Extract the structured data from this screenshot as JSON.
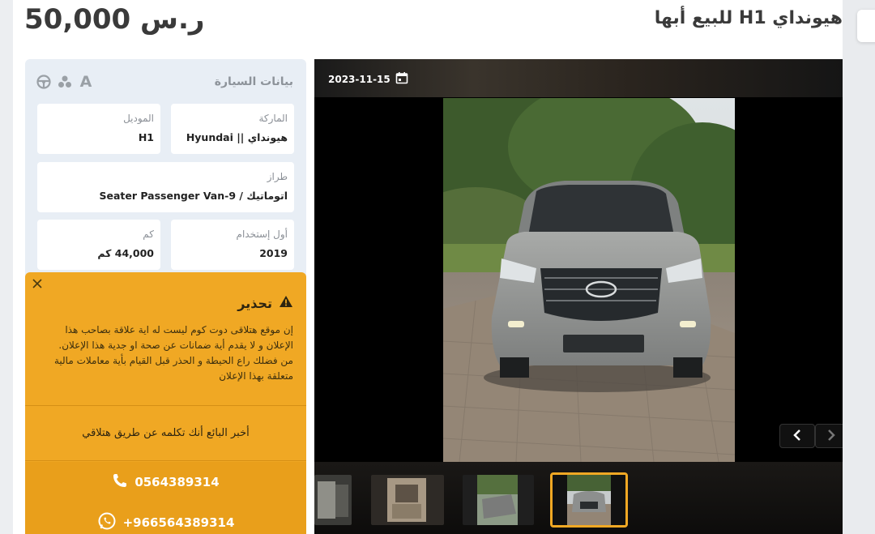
{
  "header": {
    "price": "50,000 ر.س",
    "title": "هيونداي H1 للبيع أبها"
  },
  "car_info": {
    "section_title": "بيانات السيارة",
    "icons": [
      "steering-wheel-icon",
      "recycle-icon",
      "automatic-transmission-icon"
    ],
    "fields": [
      {
        "label": "الماركة",
        "value": "هيونداي || Hyundai"
      },
      {
        "label": "الموديل",
        "value": "H1"
      },
      {
        "label": "طراز",
        "value": "اتوماتيك / 9-Seater Passenger Van"
      },
      {
        "label": "أول إستخدام",
        "value": "2019"
      },
      {
        "label": "كم",
        "value": "44,000 كم"
      }
    ]
  },
  "warning": {
    "title": "تحذير",
    "body": "إن موقع هتلاقى دوت كوم ليست له اية علاقة بصاحب هذا الإعلان و لا يقدم أية ضمانات عن صحة او جدية هذا الإعلان. من فضلك راع الحيطة و الحذر قبل القيام بأية معاملات مالية متعلقة بهذا الإعلان",
    "tell_seller": "أخبر البائع أنك تكلمه عن طريق هتلاقي",
    "phone": "0564389314",
    "whatsapp": "+966564389314"
  },
  "gallery": {
    "date": "2023-11-15",
    "prev_icon": "chevron-left-icon",
    "next_icon": "chevron-right-icon",
    "thumbnail_count": 4,
    "active_thumbnail": 4
  },
  "colors": {
    "accent": "#f0a824",
    "panel_bg": "#e8eef5",
    "text_dark": "#3a3a3a"
  }
}
